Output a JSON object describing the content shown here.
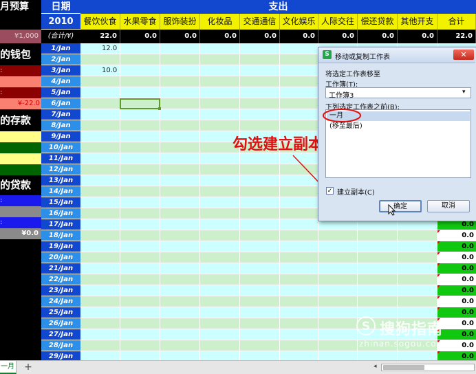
{
  "left_panel": {
    "budget_title": "月预算",
    "budget_value": "¥1,000",
    "wallet_title": "的钱包",
    "wallet_balance": "¥-22.0",
    "savings_title": "的存款",
    "loans_title": "的贷款",
    "loans_value": "¥0.0",
    "colon": ":"
  },
  "date_header": {
    "label": "日期",
    "year": "2010",
    "subtotal_label": "(合计/¥)"
  },
  "expense_header": {
    "title": "支出"
  },
  "columns": [
    "餐饮伙食",
    "水果零食",
    "服饰装扮",
    "化妆品",
    "交通通信",
    "文化娱乐",
    "人际交往",
    "偿还贷款",
    "其他开支",
    "合计"
  ],
  "totals": [
    "22.0",
    "0.0",
    "0.0",
    "0.0",
    "0.0",
    "0.0",
    "0.0",
    "0.0",
    "0.0",
    "22.0"
  ],
  "dates": [
    "1/Jan",
    "2/Jan",
    "3/Jan",
    "4/Jan",
    "5/Jan",
    "6/Jan",
    "7/Jan",
    "8/Jan",
    "9/Jan",
    "10/Jan",
    "11/Jan",
    "12/Jan",
    "13/Jan",
    "14/Jan",
    "15/Jan",
    "16/Jan",
    "17/Jan",
    "18/Jan",
    "19/Jan",
    "20/Jan",
    "21/Jan",
    "22/Jan",
    "23/Jan",
    "24/Jan",
    "25/Jan",
    "26/Jan",
    "27/Jan",
    "28/Jan",
    "29/Jan"
  ],
  "entries": [
    {
      "row": 0,
      "column": "餐饮伙食",
      "value": "12.0"
    },
    {
      "row": 2,
      "column": "餐饮伙食",
      "value": "10.0"
    }
  ],
  "row_sum_value": "0.0",
  "dialog": {
    "title": "移动或复制工作表",
    "move_to_label": "将选定工作表移至",
    "workbook_label": "工作簿(T):",
    "workbook_value": "工作簿3",
    "before_sheet_label": "下列选定工作表之前(B):",
    "sheet_options": [
      "一月",
      "(移至最后)"
    ],
    "create_copy_label": "建立副本(C)",
    "create_copy_checked": true,
    "ok_label": "确定",
    "cancel_label": "取消"
  },
  "annotation": {
    "text": "勾选建立副本"
  },
  "tabs": {
    "sheet_tab": "一月",
    "add_label": "+"
  },
  "watermark": {
    "brand": "搜狗指南",
    "url": "zhinan.sogou.com"
  },
  "colors": {
    "date_blue": "#1248d0",
    "header_yellow": "#f2f200",
    "row_cyan": "#ccffff",
    "row_green": "#ccf0cc",
    "sum_green": "#11c811",
    "annotation_red": "#e01010"
  }
}
